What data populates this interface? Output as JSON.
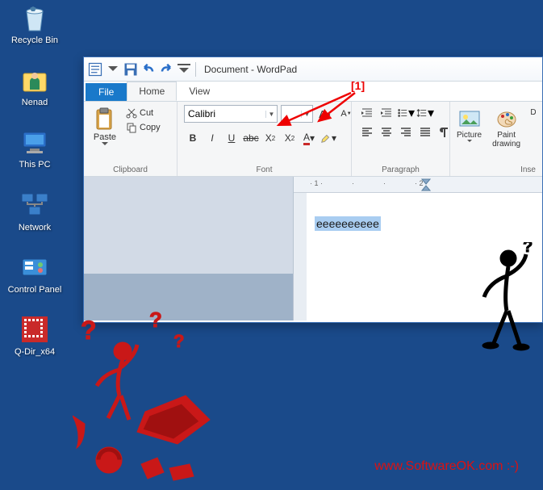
{
  "desktop": {
    "icons": [
      {
        "label": "Recycle Bin"
      },
      {
        "label": "Nenad"
      },
      {
        "label": "This PC"
      },
      {
        "label": "Network"
      },
      {
        "label": "Control Panel"
      },
      {
        "label": "Q-Dir_x64"
      }
    ]
  },
  "wordpad": {
    "title": "Document - WordPad",
    "tabs": {
      "file": "File",
      "home": "Home",
      "view": "View"
    },
    "clipboard": {
      "group": "Clipboard",
      "paste": "Paste",
      "cut": "Cut",
      "copy": "Copy"
    },
    "font": {
      "group": "Font",
      "family": "Calibri",
      "size": "",
      "grow": "Aˆ",
      "shrink": "Aˇ"
    },
    "paragraph": {
      "group": "Paragraph"
    },
    "insert": {
      "group": "Inse",
      "picture": "Picture",
      "paint": "Paint drawing",
      "d": "D"
    },
    "ruler_marks": [
      "· 1 ·",
      "·",
      "·",
      "· 2 ·"
    ],
    "document_text": "eeeeeeeeee"
  },
  "annotation": {
    "label": "[1]"
  },
  "watermark": "www.SoftwareOK.com :-)"
}
